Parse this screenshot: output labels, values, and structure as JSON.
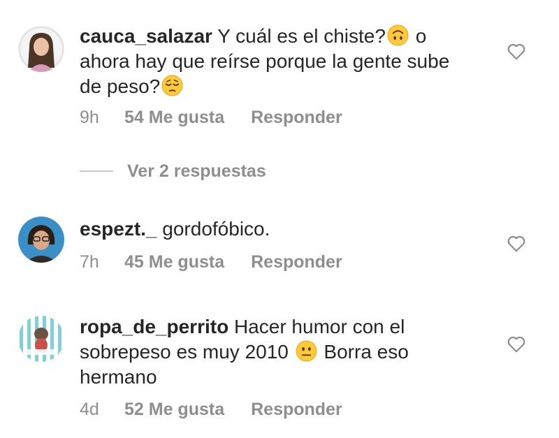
{
  "comments": [
    {
      "username": "cauca_salazar",
      "text_1": "Y cuál es el chiste?",
      "emoji_1": "upside-down-face-emoji",
      "text_2": "o ahora hay que reírse porque la gente sube de peso?",
      "emoji_2": "pensive-face-emoji",
      "time": "9h",
      "likes": "54 Me gusta",
      "reply": "Responder"
    },
    {
      "username": "espezt._",
      "text_1": "gordofóbico.",
      "time": "7h",
      "likes": "45 Me gusta",
      "reply": "Responder"
    },
    {
      "username": "ropa_de_perrito",
      "text_1": "Hacer humor con el sobrepeso es muy 2010",
      "emoji_1": "neutral-face-emoji",
      "text_2": "Borra eso hermano",
      "time": "4d",
      "likes": "52 Me gusta",
      "reply": "Responder"
    }
  ],
  "replies_toggle": {
    "label": "Ver 2 respuestas"
  },
  "icons": {
    "like": "heart-outline-icon"
  },
  "colors": {
    "text": "#262626",
    "secondary": "#8e8e8e",
    "emoji": "#FFC93A"
  }
}
